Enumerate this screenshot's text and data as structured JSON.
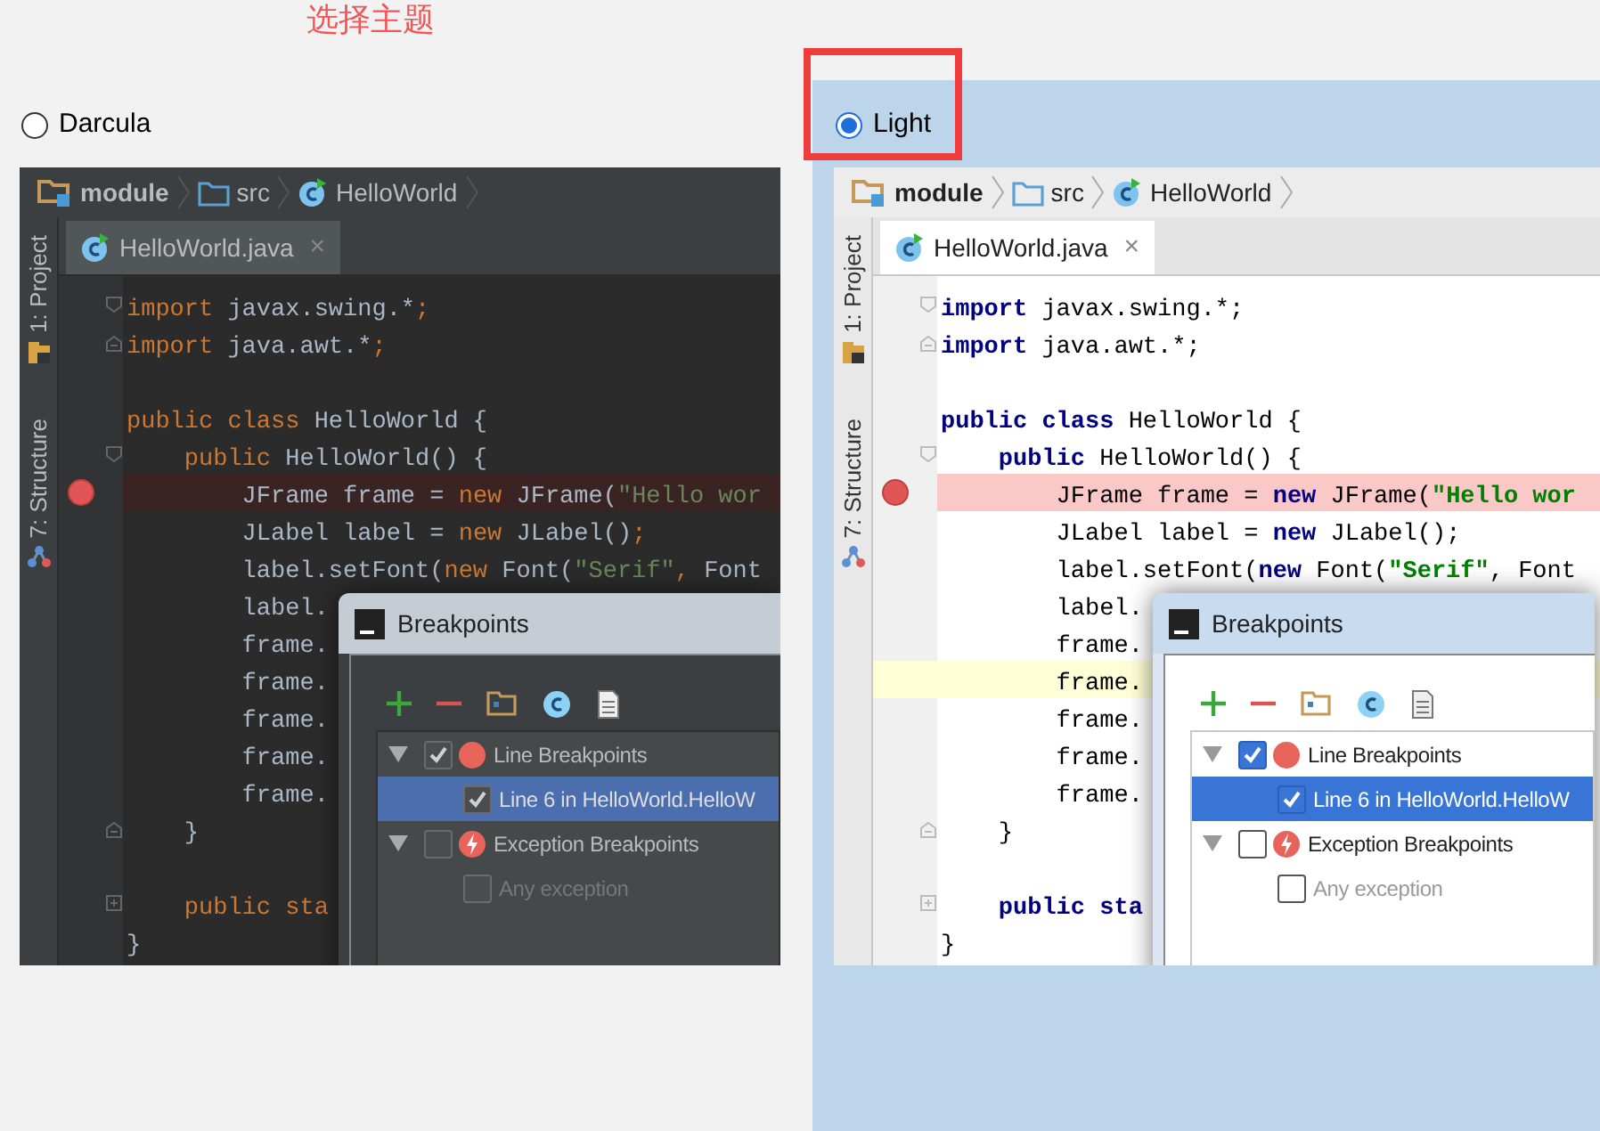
{
  "annotation": {
    "text": "选择主题",
    "highlight_selected": true
  },
  "themes": [
    {
      "kind": "dark",
      "label": "Darcula",
      "selected": false,
      "breadcrumbs": [
        "module",
        "src",
        "HelloWorld"
      ],
      "side_tabs": [
        "1: Project",
        "7: Structure"
      ],
      "editor_tab": {
        "label": "HelloWorld.java",
        "close": "×"
      },
      "code": [
        {
          "fold_marker": {
            "kind": "open"
          },
          "breakpoint": false,
          "caret": false,
          "segments": [
            {
              "kind": "kw",
              "text": "import"
            },
            {
              "kind": "plain",
              "text": " javax.swing.*"
            },
            {
              "kind": "kw",
              "text": ";"
            }
          ]
        },
        {
          "fold_marker": {
            "kind": "close"
          },
          "breakpoint": false,
          "caret": false,
          "segments": [
            {
              "kind": "kw",
              "text": "import"
            },
            {
              "kind": "plain",
              "text": " java.awt.*"
            },
            {
              "kind": "kw",
              "text": ";"
            }
          ]
        },
        {
          "breakpoint": false,
          "caret": false
        },
        {
          "breakpoint": false,
          "caret": false,
          "segments": [
            {
              "kind": "kw",
              "text": "public class"
            },
            {
              "kind": "plain",
              "text": " HelloWorld {"
            }
          ]
        },
        {
          "fold_marker": {
            "kind": "open"
          },
          "breakpoint": false,
          "caret": false,
          "segments": [
            {
              "kind": "kw",
              "text": "    public"
            },
            {
              "kind": "plain",
              "text": " HelloWorld() {"
            }
          ]
        },
        {
          "breakpoint": true,
          "caret": false,
          "segments": [
            {
              "kind": "plain",
              "text": "        JFrame frame = "
            },
            {
              "kind": "kw",
              "text": "new"
            },
            {
              "kind": "plain",
              "text": " JFrame("
            },
            {
              "kind": "str",
              "text": "\"Hello wor"
            }
          ]
        },
        {
          "breakpoint": false,
          "caret": false,
          "segments": [
            {
              "kind": "plain",
              "text": "        JLabel label = "
            },
            {
              "kind": "kw",
              "text": "new"
            },
            {
              "kind": "plain",
              "text": " JLabel()"
            },
            {
              "kind": "kw",
              "text": ";"
            }
          ]
        },
        {
          "breakpoint": false,
          "caret": false,
          "segments": [
            {
              "kind": "plain",
              "text": "        label.setFont("
            },
            {
              "kind": "kw",
              "text": "new"
            },
            {
              "kind": "plain",
              "text": " Font("
            },
            {
              "kind": "str",
              "text": "\"Serif\""
            },
            {
              "kind": "kw",
              "text": ","
            },
            {
              "kind": "plain",
              "text": " Font"
            }
          ]
        },
        {
          "breakpoint": false,
          "caret": false,
          "segments": [
            {
              "kind": "plain",
              "text": "        label."
            }
          ]
        },
        {
          "breakpoint": false,
          "caret": false,
          "segments": [
            {
              "kind": "plain",
              "text": "        frame."
            }
          ]
        },
        {
          "breakpoint": false,
          "caret": false,
          "segments": [
            {
              "kind": "plain",
              "text": "        frame."
            }
          ]
        },
        {
          "breakpoint": false,
          "caret": false,
          "segments": [
            {
              "kind": "plain",
              "text": "        frame."
            }
          ]
        },
        {
          "breakpoint": false,
          "caret": false,
          "segments": [
            {
              "kind": "plain",
              "text": "        frame."
            }
          ]
        },
        {
          "breakpoint": false,
          "caret": false,
          "segments": [
            {
              "kind": "plain",
              "text": "        frame."
            }
          ]
        },
        {
          "fold_marker": {
            "kind": "close"
          },
          "breakpoint": false,
          "caret": false,
          "segments": [
            {
              "kind": "plain",
              "text": "    }"
            }
          ]
        },
        {
          "breakpoint": false,
          "caret": false
        },
        {
          "fold_marker": {
            "kind": "collapsed"
          },
          "breakpoint": false,
          "caret": false,
          "segments": [
            {
              "kind": "kw",
              "text": "    public sta"
            }
          ]
        },
        {
          "breakpoint": false,
          "caret": false,
          "segments": [
            {
              "kind": "plain",
              "text": "}"
            }
          ]
        }
      ],
      "dialog": {
        "title": "Breakpoints",
        "tree": [
          {
            "kind": "line",
            "label": "Line Breakpoints",
            "expanded": true,
            "checked": true,
            "selected": false,
            "disabled": false,
            "children": [
              {
                "label": "Line 6 in HelloWorld.HelloW",
                "checked": true,
                "selected": true,
                "disabled": false
              }
            ]
          },
          {
            "kind": "exception",
            "label": "Exception Breakpoints",
            "expanded": true,
            "checked": false,
            "selected": false,
            "disabled": false,
            "children": [
              {
                "label": "Any exception",
                "checked": false,
                "selected": false,
                "disabled": true
              }
            ]
          }
        ]
      }
    },
    {
      "kind": "light",
      "label": "Light",
      "selected": true,
      "breadcrumbs": [
        "module",
        "src",
        "HelloWorld"
      ],
      "side_tabs": [
        "1: Project",
        "7: Structure"
      ],
      "editor_tab": {
        "label": "HelloWorld.java",
        "close": "×"
      },
      "code": [
        {
          "fold_marker": {
            "kind": "open"
          },
          "breakpoint": false,
          "caret": false,
          "segments": [
            {
              "kind": "kw",
              "text": "import"
            },
            {
              "kind": "plain",
              "text": " javax.swing.*;"
            }
          ]
        },
        {
          "fold_marker": {
            "kind": "close"
          },
          "breakpoint": false,
          "caret": false,
          "segments": [
            {
              "kind": "kw",
              "text": "import"
            },
            {
              "kind": "plain",
              "text": " java.awt.*;"
            }
          ]
        },
        {
          "breakpoint": false,
          "caret": false
        },
        {
          "breakpoint": false,
          "caret": false,
          "segments": [
            {
              "kind": "kw",
              "text": "public class"
            },
            {
              "kind": "plain",
              "text": " HelloWorld {"
            }
          ]
        },
        {
          "fold_marker": {
            "kind": "open"
          },
          "breakpoint": false,
          "caret": false,
          "segments": [
            {
              "kind": "kw",
              "text": "    public"
            },
            {
              "kind": "plain",
              "text": " HelloWorld() {"
            }
          ]
        },
        {
          "breakpoint": true,
          "caret": false,
          "segments": [
            {
              "kind": "plain",
              "text": "        JFrame frame = "
            },
            {
              "kind": "kw",
              "text": "new"
            },
            {
              "kind": "plain",
              "text": " JFrame("
            },
            {
              "kind": "str",
              "text": "\"Hello wor"
            }
          ]
        },
        {
          "breakpoint": false,
          "caret": false,
          "segments": [
            {
              "kind": "plain",
              "text": "        JLabel label = "
            },
            {
              "kind": "kw",
              "text": "new"
            },
            {
              "kind": "plain",
              "text": " JLabel();"
            }
          ]
        },
        {
          "breakpoint": false,
          "caret": false,
          "segments": [
            {
              "kind": "plain",
              "text": "        label.setFont("
            },
            {
              "kind": "kw",
              "text": "new"
            },
            {
              "kind": "plain",
              "text": " Font("
            },
            {
              "kind": "str",
              "text": "\"Serif\""
            },
            {
              "kind": "plain",
              "text": ", Font"
            }
          ]
        },
        {
          "breakpoint": false,
          "caret": false,
          "segments": [
            {
              "kind": "plain",
              "text": "        label."
            }
          ]
        },
        {
          "breakpoint": false,
          "caret": false,
          "segments": [
            {
              "kind": "plain",
              "text": "        frame."
            }
          ]
        },
        {
          "breakpoint": false,
          "caret": true,
          "segments": [
            {
              "kind": "plain",
              "text": "        frame."
            }
          ]
        },
        {
          "breakpoint": false,
          "caret": false,
          "segments": [
            {
              "kind": "plain",
              "text": "        frame."
            }
          ]
        },
        {
          "breakpoint": false,
          "caret": false,
          "segments": [
            {
              "kind": "plain",
              "text": "        frame."
            }
          ]
        },
        {
          "breakpoint": false,
          "caret": false,
          "segments": [
            {
              "kind": "plain",
              "text": "        frame."
            }
          ]
        },
        {
          "fold_marker": {
            "kind": "close"
          },
          "breakpoint": false,
          "caret": false,
          "segments": [
            {
              "kind": "plain",
              "text": "    }"
            }
          ]
        },
        {
          "breakpoint": false,
          "caret": false
        },
        {
          "fold_marker": {
            "kind": "collapsed"
          },
          "breakpoint": false,
          "caret": false,
          "segments": [
            {
              "kind": "kw",
              "text": "    public sta"
            }
          ]
        },
        {
          "breakpoint": false,
          "caret": false,
          "segments": [
            {
              "kind": "plain",
              "text": "}"
            }
          ]
        }
      ],
      "dialog": {
        "title": "Breakpoints",
        "tree": [
          {
            "kind": "line",
            "label": "Line Breakpoints",
            "expanded": true,
            "checked": true,
            "selected": false,
            "disabled": false,
            "children": [
              {
                "label": "Line 6 in HelloWorld.HelloW",
                "checked": true,
                "selected": true,
                "disabled": false
              }
            ]
          },
          {
            "kind": "exception",
            "label": "Exception Breakpoints",
            "expanded": true,
            "checked": false,
            "selected": false,
            "disabled": false,
            "children": [
              {
                "label": "Any exception",
                "checked": false,
                "selected": false,
                "disabled": true
              }
            ]
          }
        ]
      }
    }
  ]
}
